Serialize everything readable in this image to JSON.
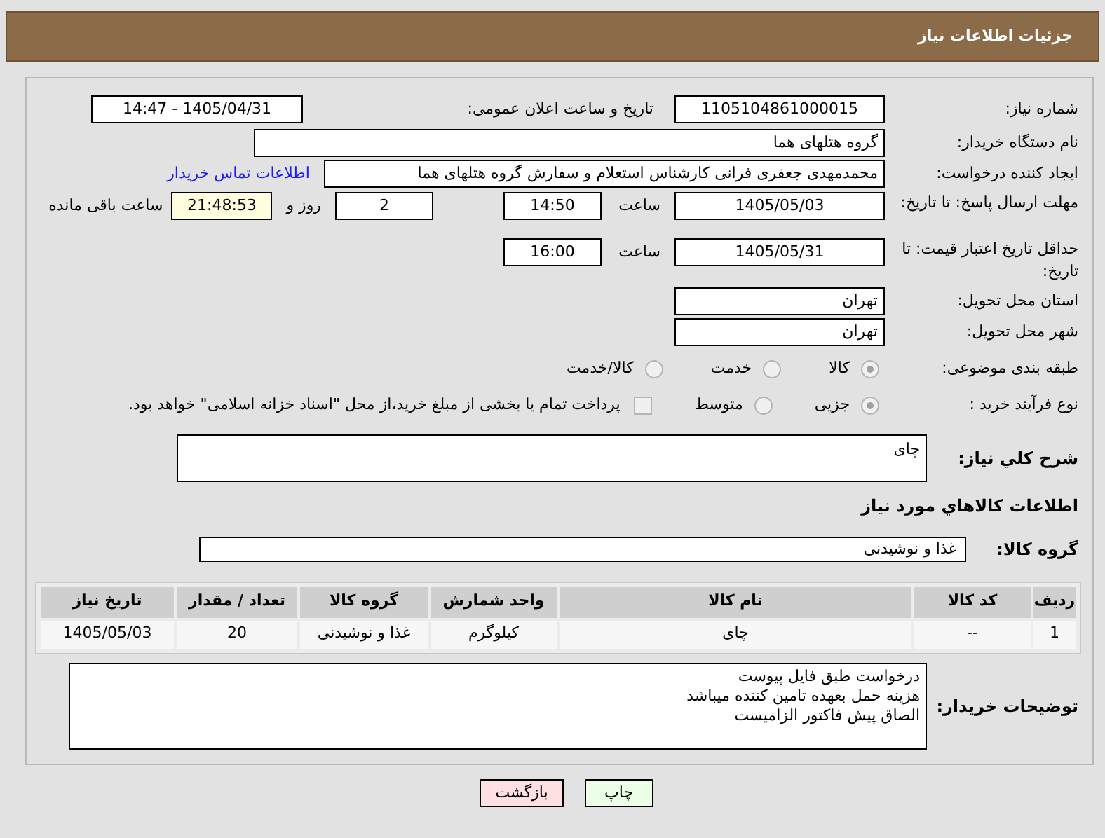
{
  "header": {
    "title": "جزئیات اطلاعات نیاز"
  },
  "need_number": {
    "label": "شماره نیاز:",
    "value": "1105104861000015"
  },
  "announce": {
    "label": "تاریخ و ساعت اعلان عمومی:",
    "value": "1405/04/31 - 14:47"
  },
  "buyer_org": {
    "label": "نام دستگاه خریدار:",
    "value": "گروه هتلهای هما"
  },
  "requester": {
    "label": "ایجاد کننده درخواست:",
    "value": "محمدمهدی جعفری فرانی کارشناس استعلام و سفارش گروه هتلهای هما",
    "link": "اطلاعات تماس خریدار"
  },
  "response_deadline": {
    "label": "مهلت ارسال پاسخ: تا تاریخ:",
    "date": "1405/05/03",
    "time_label": "ساعت",
    "time": "14:50",
    "days": "2",
    "days_label": "روز و",
    "remaining": "21:48:53",
    "remaining_label": "ساعت باقی مانده"
  },
  "price_validity": {
    "label": "حداقل تاریخ اعتبار قیمت: تا تاریخ:",
    "date": "1405/05/31",
    "time_label": "ساعت",
    "time": "16:00"
  },
  "province": {
    "label": "استان محل تحویل:",
    "value": "تهران"
  },
  "city": {
    "label": "شهر محل تحویل:",
    "value": "تهران"
  },
  "category": {
    "label": "طبقه بندی موضوعی:",
    "options": [
      {
        "label": "کالا",
        "selected": true
      },
      {
        "label": "خدمت",
        "selected": false
      },
      {
        "label": "کالا/خدمت",
        "selected": false
      }
    ]
  },
  "process": {
    "label": "نوع فرآیند خرید :",
    "options": [
      {
        "label": "جزیی",
        "selected": true
      },
      {
        "label": "متوسط",
        "selected": false
      }
    ],
    "payment": {
      "checked": false,
      "text": "پرداخت تمام یا بخشی از مبلغ خرید،از محل \"اسناد خزانه اسلامی\" خواهد بود."
    }
  },
  "description": {
    "label": "شرح کلي نياز:",
    "value": "چای"
  },
  "goods_heading": "اطلاعات کالاهاي مورد نياز",
  "goods_group": {
    "label": "گروه کالا:",
    "value": "غذا و نوشیدنی"
  },
  "table": {
    "columns": [
      "ردیف",
      "کد کالا",
      "نام کالا",
      "واحد شمارش",
      "گروه کالا",
      "تعداد / مقدار",
      "تاریخ نیاز"
    ],
    "rows": [
      [
        "1",
        "--",
        "چای",
        "کیلوگرم",
        "غذا و نوشیدنی",
        "20",
        "1405/05/03"
      ]
    ]
  },
  "buyer_notes": {
    "label": "توضیحات خریدار:",
    "lines": [
      "درخواست طبق فایل پیوست",
      "هزینه حمل بعهده تامین کننده میباشد",
      "الصاق پیش فاکتور الزامیست"
    ]
  },
  "buttons": [
    {
      "label": "چاپ",
      "kind": "print"
    },
    {
      "label": "بازگشت",
      "kind": "back"
    }
  ]
}
